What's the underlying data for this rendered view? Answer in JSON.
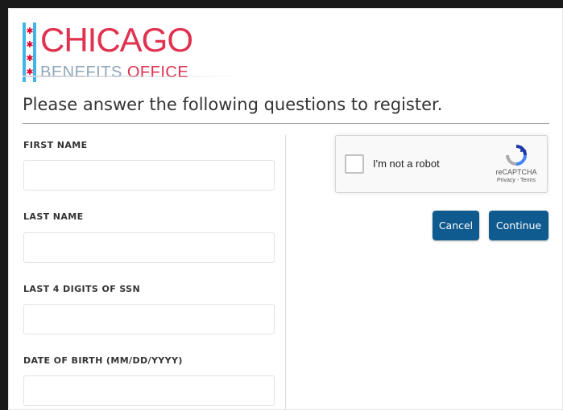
{
  "logo": {
    "title": "CHICAGO",
    "subtitle_1": "BENEFITS",
    "subtitle_2": "OFFICE"
  },
  "heading": "Please answer the following questions to register.",
  "form": {
    "fields": [
      {
        "label": "FIRST NAME",
        "value": ""
      },
      {
        "label": "LAST NAME",
        "value": ""
      },
      {
        "label": "LAST 4 DIGITS OF SSN",
        "value": ""
      },
      {
        "label": "DATE OF BIRTH (MM/DD/YYYY)",
        "value": ""
      }
    ]
  },
  "captcha": {
    "label": "I'm not a robot",
    "brand": "reCAPTCHA",
    "links": "Privacy - Terms",
    "checked": false
  },
  "actions": {
    "cancel_label": "Cancel",
    "continue_label": "Continue"
  },
  "colors": {
    "brand_red": "#e0314f",
    "flag_blue": "#41b6e6",
    "button_blue": "#0f5b8f"
  }
}
